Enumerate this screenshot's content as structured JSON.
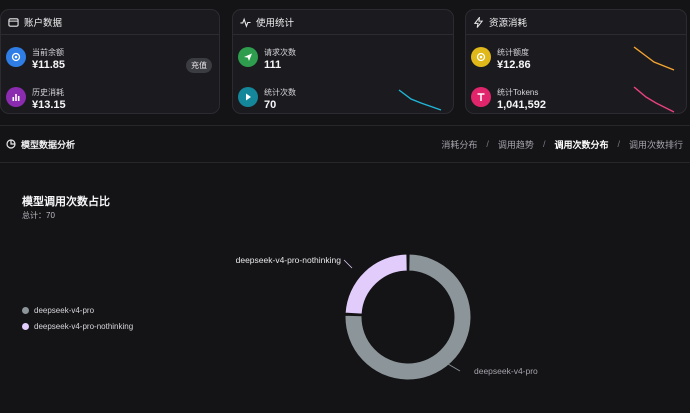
{
  "cards": {
    "account": {
      "title": "账户数据",
      "balance_label": "当前余额",
      "balance_value": "¥11.85",
      "recharge_label": "充值",
      "spent_label": "历史消耗",
      "spent_value": "¥13.15"
    },
    "usage": {
      "title": "使用统计",
      "requests_label": "请求次数",
      "requests_value": "111",
      "calls_label": "统计次数",
      "calls_value": "70"
    },
    "resource": {
      "title": "资源消耗",
      "quota_label": "统计额度",
      "quota_value": "¥12.86",
      "tokens_label": "统计Tokens",
      "tokens_value": "1,041,592"
    }
  },
  "section": {
    "title": "模型数据分析",
    "tabs": [
      {
        "label": "消耗分布",
        "active": false
      },
      {
        "label": "调用趋势",
        "active": false
      },
      {
        "label": "调用次数分布",
        "active": true
      },
      {
        "label": "调用次数排行",
        "active": false
      }
    ],
    "separator": "/"
  },
  "colors": {
    "blue": "#2f7ee6",
    "purple": "#8a2bb0",
    "green": "#2e9d4e",
    "teal": "#14879a",
    "yellow": "#e0b81a",
    "pink": "#e0256c",
    "spark_teal": "#1fb6d8",
    "spark_orange": "#f2a330",
    "spark_pink": "#e8407f",
    "slice_gray": "#8c969a",
    "slice_lavender": "#e2ccfb"
  },
  "chart_data": {
    "type": "pie",
    "title": "模型调用次数占比",
    "subtitle": "总计：70",
    "donut": true,
    "categories": [
      "deepseek-v4-pro",
      "deepseek-v4-pro-nothinking"
    ],
    "values": [
      53,
      17
    ],
    "legend_position": "left"
  }
}
